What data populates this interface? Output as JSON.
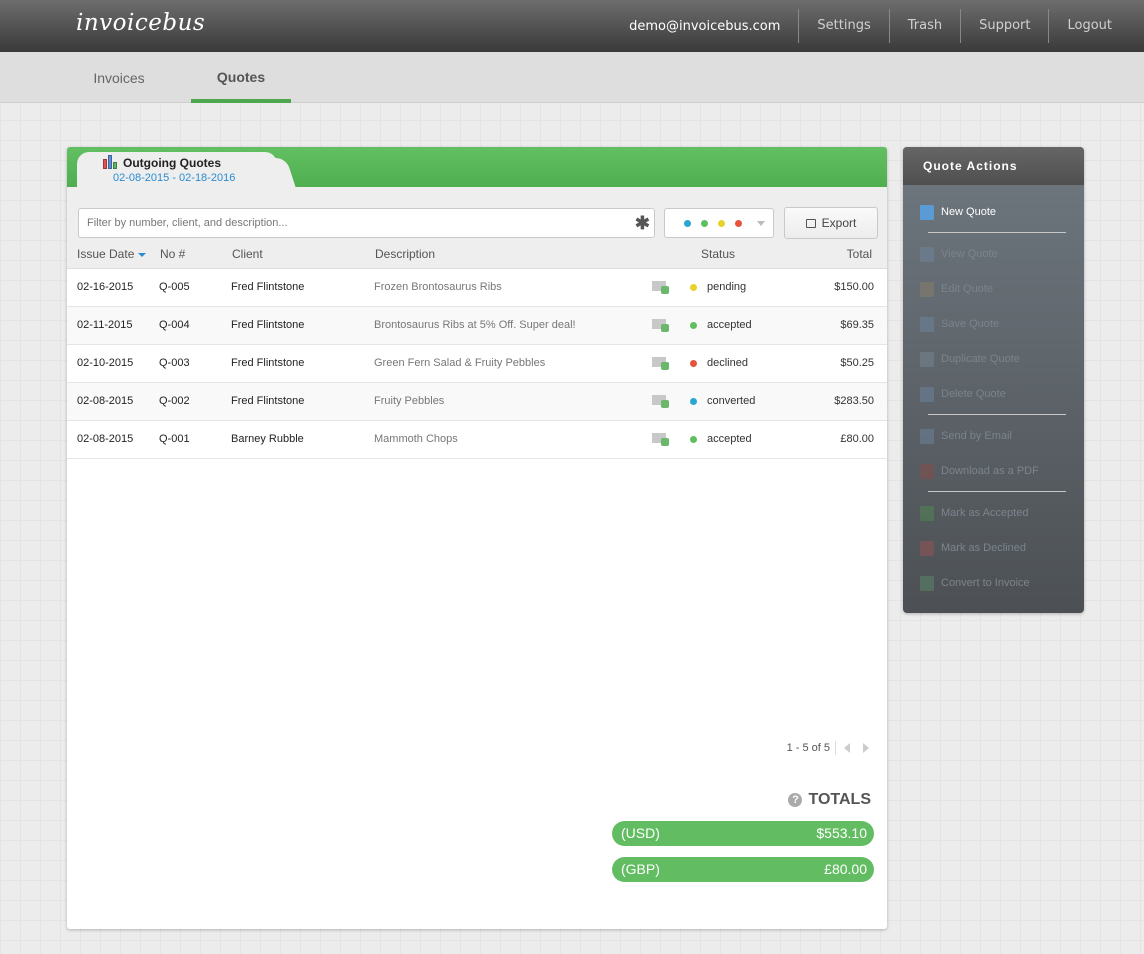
{
  "header": {
    "logo": "invoicebus",
    "user_email": "demo@invoicebus.com",
    "nav": [
      "Settings",
      "Trash",
      "Support",
      "Logout"
    ]
  },
  "subnav": {
    "tabs": [
      {
        "label": "Invoices",
        "active": false
      },
      {
        "label": "Quotes",
        "active": true
      }
    ]
  },
  "panel": {
    "title": "Outgoing Quotes",
    "date_range": "02-08-2015 - 02-18-2016",
    "filter_placeholder": "Filter by number, client, and description...",
    "filter_clear_glyph": "✱",
    "status_filter_colors": [
      "#2aa7d1",
      "#5dbf5d",
      "#e5d22a",
      "#e4533a"
    ],
    "export_label": "Export",
    "columns": [
      "Issue Date",
      "No #",
      "Client",
      "Description",
      "Status",
      "Total"
    ],
    "rows": [
      {
        "date": "02-16-2015",
        "no": "Q-005",
        "client": "Fred Flintstone",
        "description": "Frozen Brontosaurus Ribs",
        "status": "pending",
        "status_color": "#e5d22a",
        "total": "$150.00"
      },
      {
        "date": "02-11-2015",
        "no": "Q-004",
        "client": "Fred Flintstone",
        "description": "Brontosaurus Ribs at 5% Off. Super deal!",
        "status": "accepted",
        "status_color": "#5dbf5d",
        "total": "$69.35"
      },
      {
        "date": "02-10-2015",
        "no": "Q-003",
        "client": "Fred Flintstone",
        "description": "Green Fern Salad & Fruity Pebbles",
        "status": "declined",
        "status_color": "#e4533a",
        "total": "$50.25"
      },
      {
        "date": "02-08-2015",
        "no": "Q-002",
        "client": "Fred Flintstone",
        "description": "Fruity Pebbles",
        "status": "converted",
        "status_color": "#2aa7d1",
        "total": "$283.50"
      },
      {
        "date": "02-08-2015",
        "no": "Q-001",
        "client": "Barney Rubble",
        "description": "Mammoth Chops",
        "status": "accepted",
        "status_color": "#5dbf5d",
        "total": "£80.00"
      }
    ],
    "pagination": "1 - 5 of 5",
    "totals_title": "TOTALS",
    "totals": [
      {
        "currency": "(USD)",
        "amount": "$553.10"
      },
      {
        "currency": "(GBP)",
        "amount": "£80.00"
      }
    ]
  },
  "actions": {
    "title": "Quote Actions",
    "items": [
      {
        "label": "New Quote",
        "icon": "new-document-icon",
        "enabled": true,
        "color": "#5b9bd5"
      },
      {
        "label": "View Quote",
        "icon": "document-icon",
        "enabled": false,
        "color": "#6e86a0"
      },
      {
        "label": "Edit Quote",
        "icon": "pencil-icon",
        "enabled": false,
        "color": "#8a7f6a"
      },
      {
        "label": "Save Quote",
        "icon": "save-icon",
        "enabled": false,
        "color": "#6e86a0"
      },
      {
        "label": "Duplicate Quote",
        "icon": "duplicate-icon",
        "enabled": false,
        "color": "#7a8590"
      },
      {
        "label": "Delete Quote",
        "icon": "delete-document-icon",
        "enabled": false,
        "color": "#6e86a0"
      },
      {
        "label": "Send by Email",
        "icon": "email-icon",
        "enabled": false,
        "color": "#6e86a0"
      },
      {
        "label": "Download as a PDF",
        "icon": "pdf-icon",
        "enabled": false,
        "color": "#8a4a4a"
      },
      {
        "label": "Mark as Accepted",
        "icon": "check-circle-icon",
        "enabled": false,
        "color": "#4f8a4f"
      },
      {
        "label": "Mark as Declined",
        "icon": "x-circle-icon",
        "enabled": false,
        "color": "#9a5252"
      },
      {
        "label": "Convert to Invoice",
        "icon": "convert-icon",
        "enabled": false,
        "color": "#5a8a6a"
      }
    ]
  }
}
